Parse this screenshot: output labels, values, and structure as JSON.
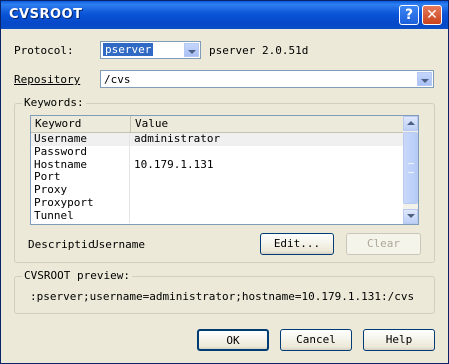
{
  "window": {
    "title": "CVSROOT",
    "help_glyph": "?",
    "close_glyph": "✕"
  },
  "protocol": {
    "label": "Protocol:",
    "value": "pserver",
    "version": "pserver 2.0.51d"
  },
  "repository": {
    "label": "Repository",
    "value": "/cvs"
  },
  "keywords": {
    "group_label": "Keywords:",
    "columns": [
      "Keyword",
      "Value"
    ],
    "rows": [
      {
        "keyword": "Username",
        "value": "administrator"
      },
      {
        "keyword": "Password",
        "value": ""
      },
      {
        "keyword": "Hostname",
        "value": "10.179.1.131"
      },
      {
        "keyword": "Port",
        "value": ""
      },
      {
        "keyword": "Proxy",
        "value": ""
      },
      {
        "keyword": "Proxyport",
        "value": ""
      },
      {
        "keyword": "Tunnel",
        "value": ""
      }
    ],
    "description_label": "Descriptic",
    "description_value": "Username",
    "edit_button": "Edit...",
    "clear_button": "Clear"
  },
  "preview": {
    "group_label": "CVSROOT preview:",
    "text": ":pserver;username=administrator;hostname=10.179.1.131:/cvs"
  },
  "buttons": {
    "ok": "OK",
    "cancel": "Cancel",
    "help": "Help"
  }
}
